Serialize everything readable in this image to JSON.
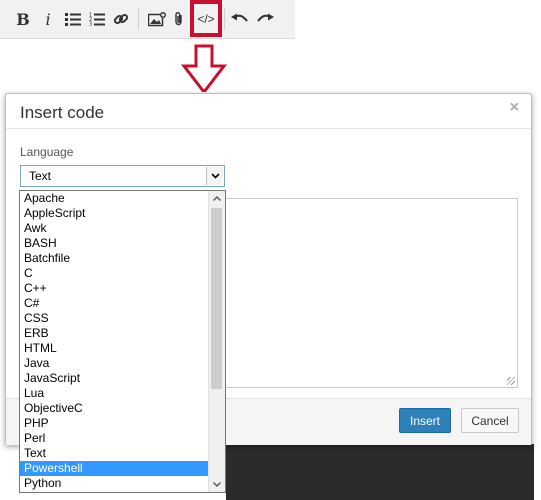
{
  "toolbar": {
    "bold_label": "B",
    "italic_label": "i",
    "code_label": "</>"
  },
  "dialog": {
    "title": "Insert code",
    "close_label": "×",
    "language_label": "Language",
    "selected_language": "Text",
    "insert_label": "Insert",
    "cancel_label": "Cancel"
  },
  "dropdown": {
    "options": [
      "Apache",
      "AppleScript",
      "Awk",
      "BASH",
      "Batchfile",
      "C",
      "C++",
      "C#",
      "CSS",
      "ERB",
      "HTML",
      "Java",
      "JavaScript",
      "Lua",
      "ObjectiveC",
      "PHP",
      "Perl",
      "Text",
      "Powershell",
      "Python"
    ],
    "highlighted": "Powershell"
  },
  "colors": {
    "highlight_box": "#c8102e",
    "insert_button": "#2e80b8",
    "selected_option": "#3399ff"
  }
}
